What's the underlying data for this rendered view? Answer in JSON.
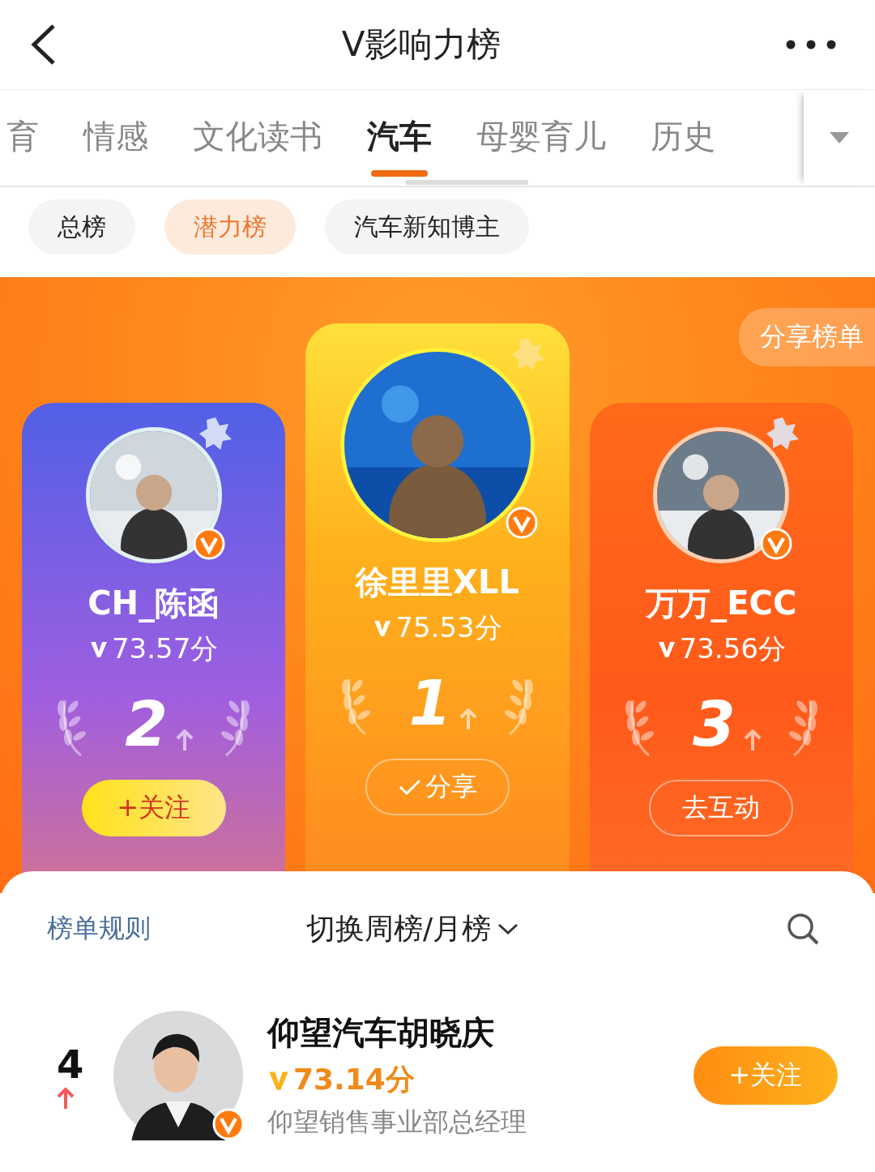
{
  "header": {
    "title": "V影响力榜"
  },
  "tabs": [
    {
      "label": "育",
      "selected": false
    },
    {
      "label": "情感",
      "selected": false
    },
    {
      "label": "文化读书",
      "selected": false
    },
    {
      "label": "汽车",
      "selected": true
    },
    {
      "label": "母婴育儿",
      "selected": false
    },
    {
      "label": "历史",
      "selected": false
    }
  ],
  "chips": [
    {
      "label": "总榜",
      "selected": false
    },
    {
      "label": "潜力榜",
      "selected": true
    },
    {
      "label": "汽车新知博主",
      "selected": false
    }
  ],
  "share_list_button": "分享榜单",
  "podium": [
    {
      "kind": "silver",
      "name": "CH_陈函",
      "score": "73.57分",
      "rank": "2",
      "action": {
        "kind": "follow",
        "label": "+关注"
      }
    },
    {
      "kind": "gold",
      "name": "徐里里XLL",
      "score": "75.53分",
      "rank": "1",
      "action": {
        "kind": "shared",
        "label": "分享"
      }
    },
    {
      "kind": "bronze",
      "name": "万万_ECC",
      "score": "73.56分",
      "rank": "3",
      "action": {
        "kind": "outline",
        "label": "去互动"
      }
    }
  ],
  "toolbar": {
    "rules_link": "榜单规则",
    "period_switch": "切换周榜/月榜",
    "period_switch_expanded": false
  },
  "list": [
    {
      "rank": "4",
      "name": "仰望汽车胡晓庆",
      "score": "73.14分",
      "description": "仰望销售事业部总经理",
      "button": "+关注"
    }
  ]
}
